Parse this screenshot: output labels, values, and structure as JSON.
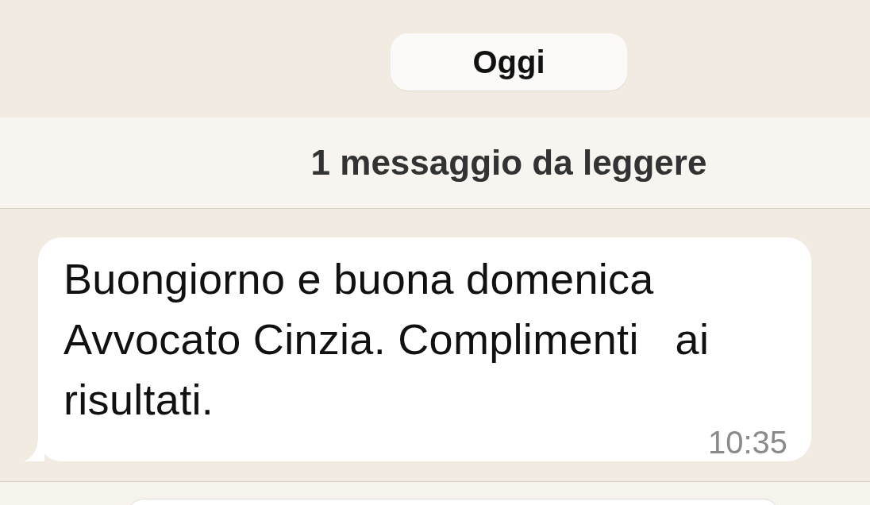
{
  "date_chip": "Oggi",
  "unread_banner": "1 messaggio da leggere",
  "messages": [
    {
      "text": "Buongiorno e buona domenica Avvocato Cinzia. Complimenti   ai risultati.",
      "time": "10:35"
    }
  ]
}
